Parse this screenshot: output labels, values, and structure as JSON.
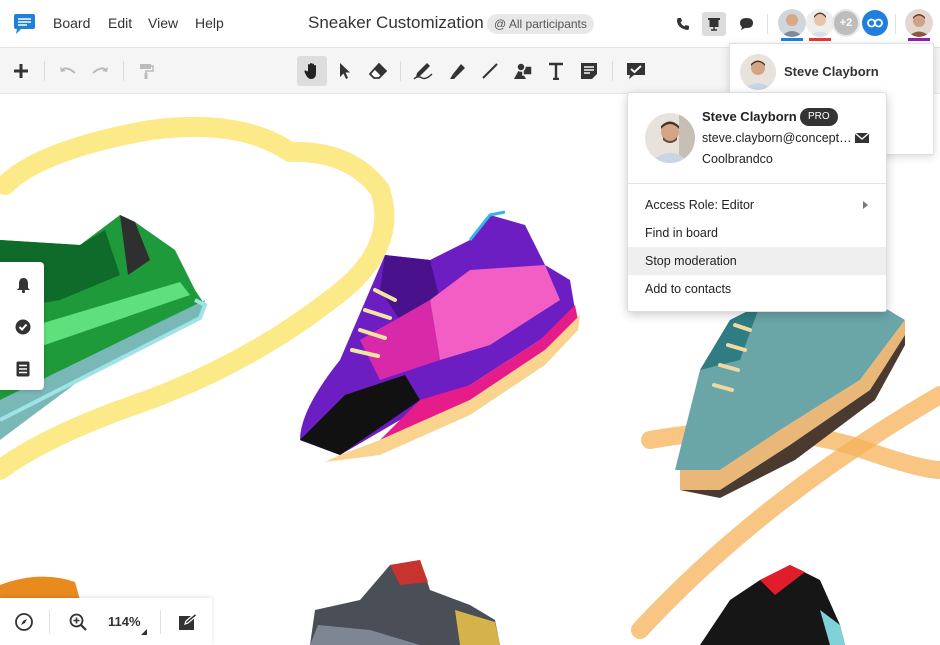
{
  "menubar": {
    "items": [
      "Board",
      "Edit",
      "View",
      "Help"
    ],
    "board_title": "Sneaker Customization",
    "participants_pill": "@ All participants",
    "more_participants": "+2"
  },
  "toolbar": {
    "tools": [
      "add",
      "undo",
      "redo",
      "format-painter",
      "hand",
      "select",
      "eraser",
      "pen",
      "highlighter",
      "line",
      "shapes",
      "text",
      "sticky-note",
      "comment"
    ],
    "active_tool": "hand"
  },
  "bottom": {
    "zoom": "114%"
  },
  "mini_card": {
    "name": "Steve Clayborn"
  },
  "popover": {
    "name": "Steve Clayborn",
    "badge": "PRO",
    "email": "steve.clayborn@conceptboard.com",
    "company": "Coolbrandco",
    "menu": [
      {
        "label": "Access Role: Editor",
        "has_submenu": true
      },
      {
        "label": "Find in board"
      },
      {
        "label": "Stop moderation",
        "highlighted": true
      },
      {
        "label": "Add to contacts"
      }
    ]
  },
  "colors": {
    "brand_blue": "#1f7fdc",
    "highlighter_yellow": "#fbe87a",
    "highlighter_orange": "#f5b25a"
  }
}
